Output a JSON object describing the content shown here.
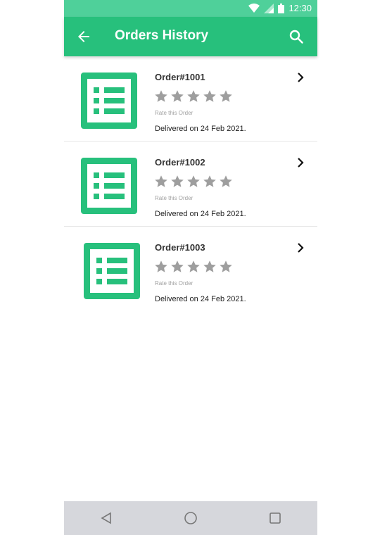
{
  "status_bar": {
    "time": "12:30",
    "icons": [
      "wifi-icon",
      "signal-icon",
      "battery-icon"
    ]
  },
  "app_bar": {
    "title": "Orders History",
    "back_icon": "arrow-left-icon",
    "search_icon": "search-icon",
    "color": "#27c07c"
  },
  "orders": [
    {
      "id": "Order#1001",
      "rating_label": "Rate this Order",
      "stars": 0,
      "delivered": "Delivered on 24 Feb 2021."
    },
    {
      "id": "Order#1002",
      "rating_label": "Rate this Order",
      "stars": 0,
      "delivered": "Delivered on 24 Feb 2021."
    },
    {
      "id": "Order#1003",
      "rating_label": "Rate this Order",
      "stars": 0,
      "delivered": "Delivered on 24 Feb 2021."
    }
  ],
  "nav_bar": {
    "buttons": [
      "back-triangle-icon",
      "home-circle-icon",
      "recents-square-icon"
    ]
  },
  "colors": {
    "accent": "#27c07c",
    "status_bar": "#4fd09a",
    "star": "#9e9e9e"
  }
}
